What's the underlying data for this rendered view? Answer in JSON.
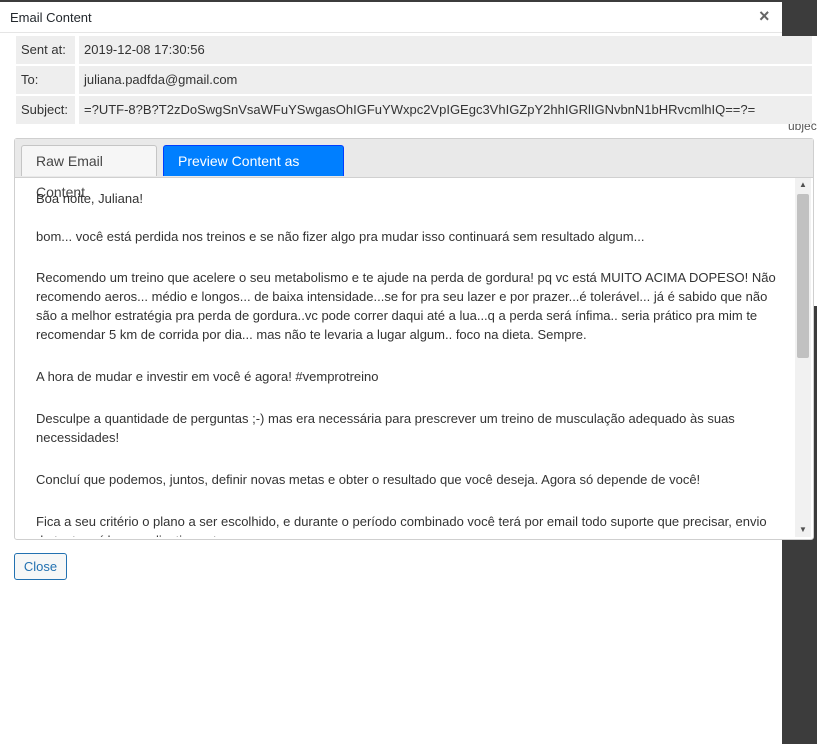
{
  "modal": {
    "title": "Email Content",
    "close_icon": "×"
  },
  "meta": {
    "sent_at_label": "Sent at:",
    "sent_at_value": "2019-12-08 17:30:56",
    "to_label": "To:",
    "to_value": "juliana.padfda@gmail.com",
    "subject_label": "Subject:",
    "subject_value": "=?UTF-8?B?T2zDoSwgSnVsaWFuYSwgasOhIGFuYWxpc2VpIGEgc3VhIGZpY2hhIGRlIGNvbnN1bHRvcmlhIQ==?="
  },
  "tabs": {
    "raw_label": "Raw Email Content",
    "html_label": "Preview Content as HTML"
  },
  "email_body": {
    "p1": "Boa noite, Juliana!",
    "p2": "bom... você está perdida nos treinos e se não fizer algo pra mudar isso continuará sem resultado algum...",
    "p3": "Recomendo um treino que acelere o seu metabolismo e te ajude na perda de gordura! pq vc está MUITO ACIMA DOPESO! Não recomendo aeros... médio e longos... de baixa intensidade...se for pra seu lazer e por prazer...é tolerável... já é sabido que não são a melhor estratégia pra perda de gordura..vc pode correr daqui até a lua...q a perda será ínfima.. seria prático pra mim te recomendar 5 km de corrida por dia... mas não te levaria a lugar algum.. foco na dieta. Sempre.",
    "p4": "A hora de mudar e investir em você é agora! #vemprotreino",
    "p5": "Desculpe a quantidade de perguntas ;-) mas era necessária para prescrever um treino de musculação adequado às suas necessidades!",
    "p6": "Concluí que podemos, juntos, definir novas metas e obter o resultado que você deseja. Agora só depende de você!",
    "p7": "Fica a seu critério o plano a ser escolhido, e durante o período combinado você terá por email todo suporte que precisar, envio de tantos vídeos explicativos etc."
  },
  "footer": {
    "close_label": "Close"
  },
  "background": {
    "partial_text": "ubjec"
  },
  "icons": {
    "close": "close-icon",
    "scroll_up": "chevron-up-icon",
    "scroll_down": "chevron-down-icon"
  },
  "colors": {
    "accent": "#007fff",
    "button_border": "#2271b1"
  }
}
